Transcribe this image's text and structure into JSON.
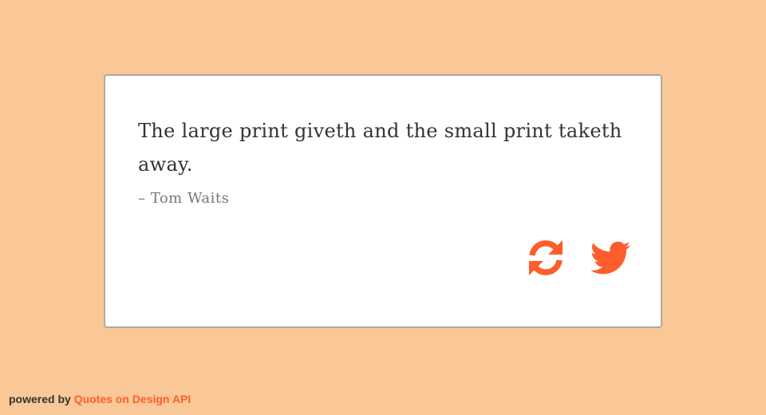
{
  "quote": {
    "text": "The large print giveth and the small print taketh away.",
    "author": "– Tom Waits"
  },
  "actions": {
    "new_quote_icon": "refresh-icon",
    "tweet_icon": "twitter-icon",
    "accent_color": "#fd5d2c"
  },
  "footer": {
    "prefix": "powered by",
    "link_label": "Quotes on Design API"
  },
  "theme": {
    "background": "#f9c896",
    "card_background": "#ffffff",
    "card_border": "#a9a9a9"
  }
}
